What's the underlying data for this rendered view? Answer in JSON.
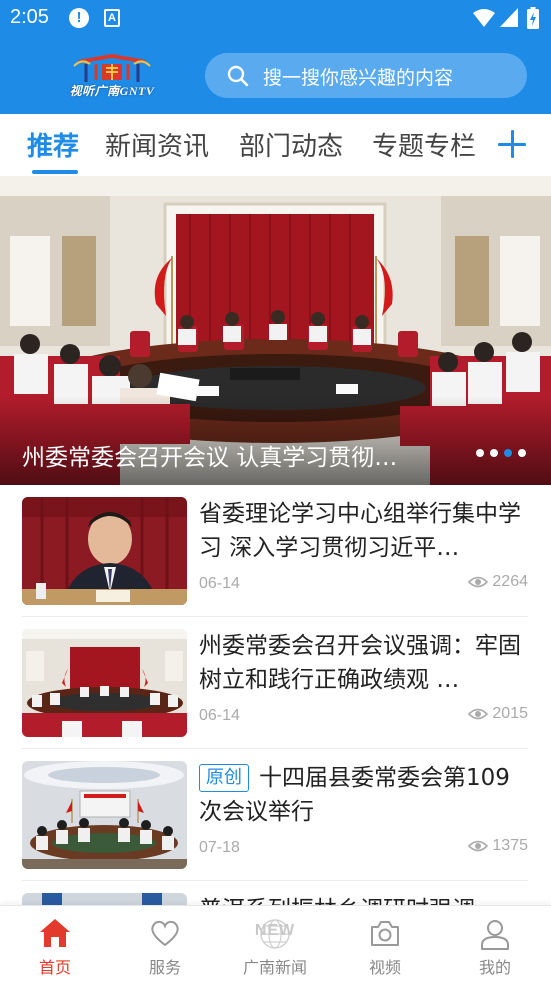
{
  "status_bar": {
    "time": "2:05",
    "alert_glyph": "!",
    "app_glyph": "A",
    "icons": [
      "alert-icon",
      "app-notification-icon",
      "wifi-icon",
      "signal-icon",
      "battery-charging-icon"
    ]
  },
  "app_bar": {
    "logo_text": "视听广南GNTV",
    "search_placeholder": "搜一搜你感兴趣的内容",
    "colors": {
      "primary": "#1e8be6",
      "search_bg": "#5aaaf0"
    }
  },
  "tabs": {
    "items": [
      {
        "label": "推荐",
        "active": true
      },
      {
        "label": "新闻资讯",
        "active": false
      },
      {
        "label": "部门动态",
        "active": false
      },
      {
        "label": "专题专栏",
        "active": false
      }
    ],
    "add_icon": "plus-icon"
  },
  "banner": {
    "caption": "州委常委会召开会议  认真学习贯彻…",
    "slide_count": 4,
    "active_slide": 3
  },
  "news": [
    {
      "title": "省委理论学习中心组举行集中学习  深入学习贯彻习近平…",
      "tag": "",
      "date": "06-14",
      "views": "2264"
    },
    {
      "title": "州委常委会召开会议强调：牢固树立和践行正确政绩观  …",
      "tag": "",
      "date": "06-14",
      "views": "2015"
    },
    {
      "title": "十四届县委常委会第109次会议举行",
      "tag": "原创",
      "date": "07-18",
      "views": "1375"
    }
  ],
  "partial_item": {
    "title": "普洱系列振林乡调研时强调"
  },
  "bottom_nav": {
    "items": [
      {
        "label": "首页",
        "icon": "home-icon",
        "active": true
      },
      {
        "label": "服务",
        "icon": "heart-icon",
        "active": false
      },
      {
        "label": "广南新闻",
        "icon": "new-globe-icon",
        "badge": "NEW",
        "active": false
      },
      {
        "label": "视频",
        "icon": "camera-icon",
        "active": false
      },
      {
        "label": "我的",
        "icon": "user-icon",
        "active": false
      }
    ],
    "colors": {
      "active": "#e23b2e",
      "inactive": "#888888"
    }
  }
}
